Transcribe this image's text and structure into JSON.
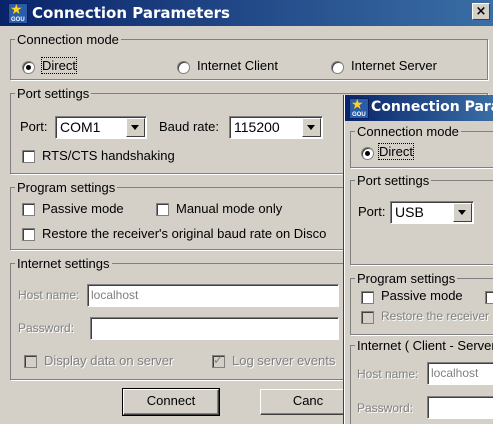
{
  "dialog1": {
    "title": "Connection Parameters",
    "icon_text": "GOU",
    "close_glyph": "×",
    "connection_mode": {
      "legend": "Connection mode",
      "options": [
        "Direct",
        "Internet Client",
        "Internet Server"
      ],
      "selected": "Direct"
    },
    "port_settings": {
      "legend": "Port settings",
      "port_label": "Port:",
      "port_value": "COM1",
      "baud_label": "Baud rate:",
      "baud_value": "115200",
      "rts_label": "RTS/CTS handshaking"
    },
    "program_settings": {
      "legend": "Program settings",
      "passive_label": "Passive mode",
      "manual_label": "Manual mode only",
      "restore_label": "Restore the receiver's original baud rate on Disco"
    },
    "internet_settings": {
      "legend": "Internet settings",
      "host_label": "Host name:",
      "host_value": "localhost",
      "password_label": "Password:",
      "display_label": "Display data on server",
      "log_label": "Log server events"
    },
    "connect_button": "Connect",
    "cancel_button": "Canc"
  },
  "dialog2": {
    "title": "Connection Parame",
    "icon_text": "GOU",
    "connection_mode": {
      "legend": "Connection mode",
      "direct_label": "Direct"
    },
    "port_settings": {
      "legend": "Port settings",
      "port_label": "Port:",
      "port_value": "USB"
    },
    "program_settings": {
      "legend": "Program settings",
      "passive_label": "Passive mode",
      "restore_label": "Restore the receiver"
    },
    "internet_settings": {
      "legend": "Internet ( Client - Server",
      "host_label": "Host name:",
      "host_value": "localhost",
      "password_label": "Password:"
    }
  }
}
